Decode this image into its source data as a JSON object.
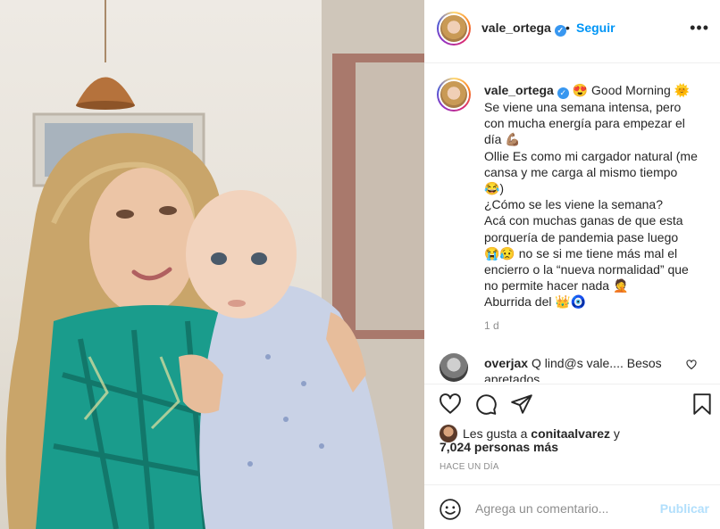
{
  "post": {
    "username": "vale_ortega",
    "follow_label": "Seguir",
    "separator": "•",
    "more_icon": "•••",
    "verified_icon": "✓",
    "caption_lines": [
      "😍 Good Morning 🌞",
      "Se viene una semana intensa, pero",
      "con mucha energía para empezar el",
      "día 💪🏽",
      "Ollie Es como mi cargador natural (me",
      "cansa y me carga al mismo tiempo",
      "😂)",
      "¿Cómo se les viene la semana?",
      "Acá con muchas ganas de que esta",
      "porquería de pandemia pase luego",
      "😭😥 no se si me tiene más mal el",
      "encierro o la “nueva normalidad” que",
      "no permite hacer nada 🤦",
      "Aburrida del 👑🧿"
    ],
    "time_ago": "1 d",
    "comment": {
      "username": "overjax",
      "text": "Q lind@s vale.... Besos apretados"
    },
    "likes": {
      "prefix": "Les gusta a",
      "user": "conitaalvarez",
      "conjunction": "y",
      "others": "7,024 personas más"
    },
    "posted": "HACE UN DÍA",
    "add_comment_placeholder": "Agrega un comentario...",
    "publish_label": "Publicar"
  },
  "colors": {
    "accent": "#0095f6",
    "verified": "#3897f0",
    "muted": "#8e8e8e",
    "publish_disabled": "#b2dffc"
  },
  "icons": [
    "heart-icon",
    "comment-icon",
    "share-icon",
    "bookmark-icon",
    "emoji-icon",
    "more-icon",
    "verified-icon"
  ]
}
